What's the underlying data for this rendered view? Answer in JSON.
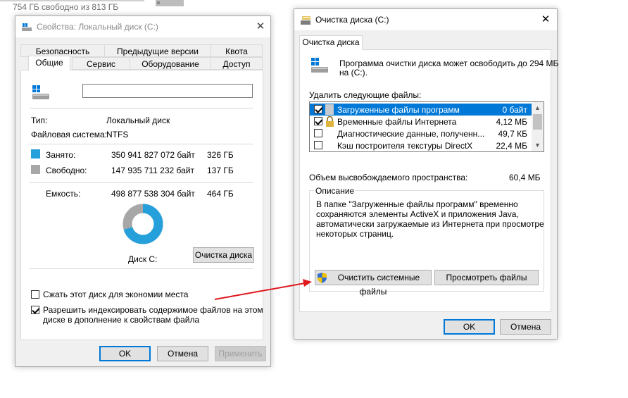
{
  "top_strip": {
    "text": "754 ГБ свободно из 813 ГБ"
  },
  "props": {
    "title": "Свойства: Локальный диск (C:)",
    "tabs_row1": [
      "Безопасность",
      "Предыдущие версии",
      "Квота"
    ],
    "tabs_row2": [
      "Общие",
      "Сервис",
      "Оборудование",
      "Доступ"
    ],
    "name_value": "",
    "type_label": "Тип:",
    "type_value": "Локальный диск",
    "fs_label": "Файловая система:",
    "fs_value": "NTFS",
    "used_label": "Занято:",
    "used_bytes": "350 941 827 072 байт",
    "used_gb": "326 ГБ",
    "free_label": "Свободно:",
    "free_bytes": "147 935 711 232 байт",
    "free_gb": "137 ГБ",
    "cap_label": "Емкость:",
    "cap_bytes": "498 877 538 304 байт",
    "cap_gb": "464 ГБ",
    "used_fraction": 0.7035,
    "disk_label": "Диск C:",
    "cleanup_btn": "Очистка диска",
    "compress_label": "Сжать этот диск для экономии места",
    "compress_checked": false,
    "index_label_1": "Разрешить индексировать содержимое файлов на этом",
    "index_label_2": "диске в дополнение к свойствам файла",
    "index_checked": true,
    "ok": "OK",
    "cancel": "Отмена",
    "apply": "Применить",
    "colors": {
      "used": "#26a0da",
      "free": "#a7a7a7"
    }
  },
  "cleanup": {
    "title": "Очистка диска  (C:)",
    "tab": "Очистка диска",
    "intro_1": "Программа очистки диска может освободить до 294 МБ",
    "intro_2": "на  (C:).",
    "delete_label": "Удалить следующие файлы:",
    "items": [
      {
        "name": "Загруженные файлы программ",
        "size": "0 байт",
        "checked": true,
        "selected": true
      },
      {
        "name": "Временные файлы Интернета",
        "size": "4,12 МБ",
        "checked": true,
        "selected": false
      },
      {
        "name": "Диагностические данные, полученн...",
        "size": "49,7 КБ",
        "checked": false,
        "selected": false
      },
      {
        "name": "Кэш построителя текстуры DirectX",
        "size": "22,4 МБ",
        "checked": false,
        "selected": false
      }
    ],
    "space_label": "Объем высвобождаемого пространства:",
    "space_value": "60,4 МБ",
    "desc_title": "Описание",
    "desc_1": "В папке \"Загруженные файлы программ\" временно",
    "desc_2": "сохраняются элементы ActiveX и приложения Java,",
    "desc_3": "автоматически загружаемые из Интернета при просмотре",
    "desc_4": "некоторых страниц.",
    "sys_btn": "Очистить системные файлы",
    "view_btn": "Просмотреть файлы",
    "ok": "OK",
    "cancel": "Отмена"
  }
}
